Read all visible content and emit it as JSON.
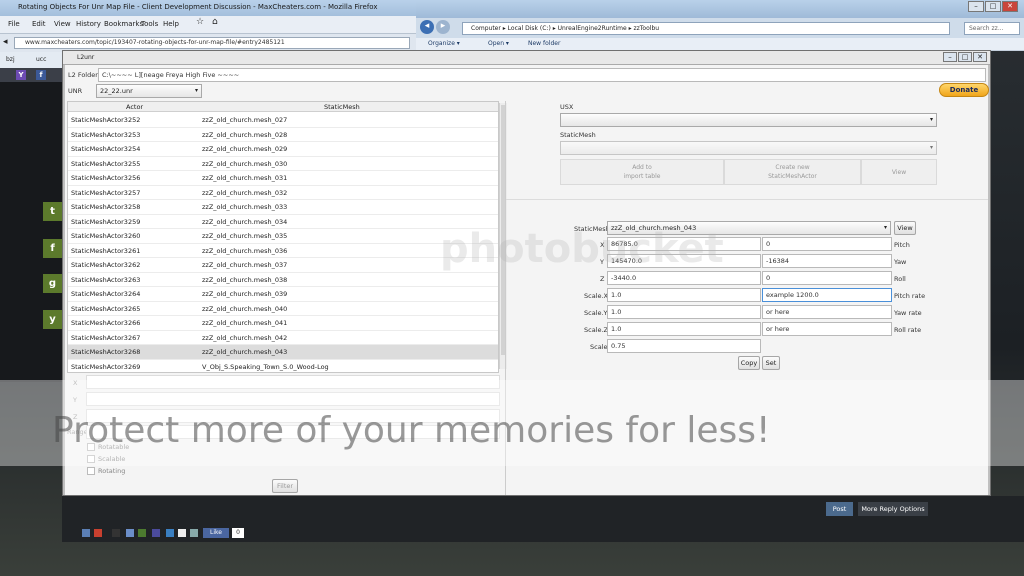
{
  "firefox": {
    "title": "Rotating Objects For Unr Map File - Client Development Discussion - MaxCheaters.com - Mozilla Firefox",
    "menu": [
      "File",
      "Edit",
      "View",
      "History",
      "Bookmarks",
      "Tools",
      "Help"
    ],
    "url": "www.maxcheaters.com/topic/193407-rotating-objects-for-unr-map-file/#entry2485121",
    "bookmarks": [
      "bzj",
      "ucc"
    ]
  },
  "explorer": {
    "breadcrumbs": [
      "Computer",
      "Local Disk (C:)",
      "UnrealEngine2Runtime",
      "zzToolbu"
    ],
    "search_placeholder": "Search zz...",
    "toolbar": [
      "Organize ▾",
      "Open ▾",
      "New folder"
    ]
  },
  "app": {
    "title": "L2unr",
    "l2folder_label": "L2 Folder",
    "l2folder_value": "C:\\~~~~ L][neage Freya High Five ~~~~",
    "unr_label": "UNR",
    "unr_value": "22_22.unr",
    "donate": "Donate",
    "table": {
      "headers": [
        "Actor",
        "StaticMesh"
      ],
      "rows": [
        [
          "StaticMeshActor3252",
          "zzZ_old_church.mesh_027"
        ],
        [
          "StaticMeshActor3253",
          "zzZ_old_church.mesh_028"
        ],
        [
          "StaticMeshActor3254",
          "zzZ_old_church.mesh_029"
        ],
        [
          "StaticMeshActor3255",
          "zzZ_old_church.mesh_030"
        ],
        [
          "StaticMeshActor3256",
          "zzZ_old_church.mesh_031"
        ],
        [
          "StaticMeshActor3257",
          "zzZ_old_church.mesh_032"
        ],
        [
          "StaticMeshActor3258",
          "zzZ_old_church.mesh_033"
        ],
        [
          "StaticMeshActor3259",
          "zzZ_old_church.mesh_034"
        ],
        [
          "StaticMeshActor3260",
          "zzZ_old_church.mesh_035"
        ],
        [
          "StaticMeshActor3261",
          "zzZ_old_church.mesh_036"
        ],
        [
          "StaticMeshActor3262",
          "zzZ_old_church.mesh_037"
        ],
        [
          "StaticMeshActor3263",
          "zzZ_old_church.mesh_038"
        ],
        [
          "StaticMeshActor3264",
          "zzZ_old_church.mesh_039"
        ],
        [
          "StaticMeshActor3265",
          "zzZ_old_church.mesh_040"
        ],
        [
          "StaticMeshActor3266",
          "zzZ_old_church.mesh_041"
        ],
        [
          "StaticMeshActor3267",
          "zzZ_old_church.mesh_042"
        ],
        [
          "StaticMeshActor3268",
          "zzZ_old_church.mesh_043"
        ],
        [
          "StaticMeshActor3269",
          "V_Obj_S.Speaking_Town_S.0_Wood-Log"
        ]
      ],
      "selected_index": 16
    },
    "filter": {
      "labels": [
        "X",
        "Y",
        "Z",
        "Range"
      ],
      "checks": [
        "Rotatable",
        "Scalable",
        "Rotating"
      ],
      "button": "Filter"
    },
    "right": {
      "usx_label": "USX",
      "staticmesh_label": "StaticMesh",
      "add_to_import": "Add to\nimport table",
      "create_new": "Create new\nStaticMeshActor",
      "view_disabled": "View",
      "sm_label": "StaticMesh",
      "sm_value": "zzZ_old_church.mesh_043",
      "view_button": "View",
      "x_label": "X",
      "x_value": "86785.0",
      "y_label": "Y",
      "y_value": "145470.0",
      "z_label": "Z",
      "z_value": "-3440.0",
      "scalex_label": "Scale.X",
      "scalex_value": "1.0",
      "scaley_label": "Scale.Y",
      "scaley_value": "1.0",
      "scalez_label": "Scale.Z",
      "scalez_value": "1.0",
      "scale_label": "Scale",
      "scale_value": "0.75",
      "pitch_value": "0",
      "pitch_label": "Pitch",
      "yaw_value": "-16384",
      "yaw_label": "Yaw",
      "roll_value": "0",
      "roll_label": "Roll",
      "pitchrate_value": "example 1200.0",
      "pitchrate_label": "Pitch rate",
      "yawrate_value": "or here",
      "yawrate_label": "Yaw rate",
      "rollrate_value": "or here",
      "rollrate_label": "Roll rate",
      "copy": "Copy",
      "set": "Set"
    }
  },
  "overlay_text": "Protect more of your memories for less!",
  "forum": {
    "post": "Post",
    "more_reply": "More Reply Options",
    "like": "Like",
    "like_count": "0"
  }
}
